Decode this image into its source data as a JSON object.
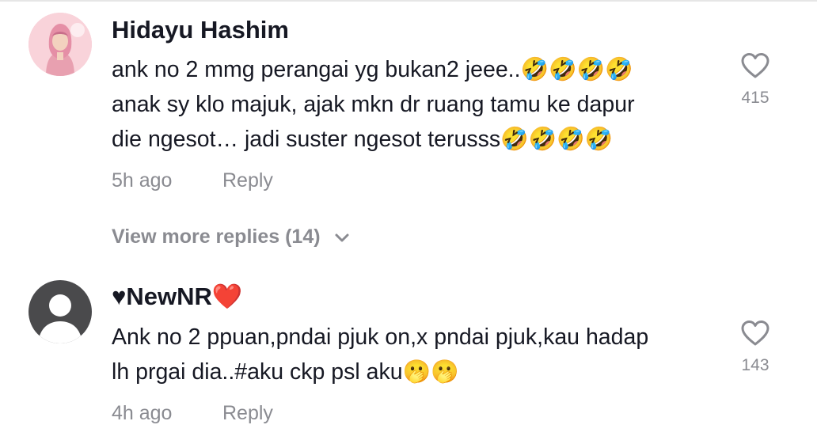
{
  "comments": [
    {
      "username": "Hidayu Hashim",
      "lines": [
        "ank no 2 mmg perangai yg bukan2 jeee..🤣🤣🤣🤣",
        "anak sy klo majuk, ajak mkn dr ruang tamu ke dapur",
        "die ngesot… jadi suster ngesot terusss🤣🤣🤣🤣"
      ],
      "time": "5h ago",
      "reply_label": "Reply",
      "likes": "415",
      "view_more": "View more replies (14)"
    },
    {
      "username": "♥NewNR❤️",
      "lines": [
        "Ank no 2 ppuan,pndai pjuk on,x pndai pjuk,kau hadap",
        "lh prgai dia..#aku ckp psl aku🫢🫢"
      ],
      "time": "4h ago",
      "reply_label": "Reply",
      "likes": "143"
    }
  ],
  "icons": {
    "like": "heart-outline-icon",
    "expand": "chevron-down-icon",
    "default_avatar": "person-silhouette-icon"
  },
  "colors": {
    "text_primary": "#161823",
    "text_secondary": "#8a8b91",
    "avatar_default_bg": "#4a4a4c",
    "avatar1_bg": "#f7c6cf"
  }
}
